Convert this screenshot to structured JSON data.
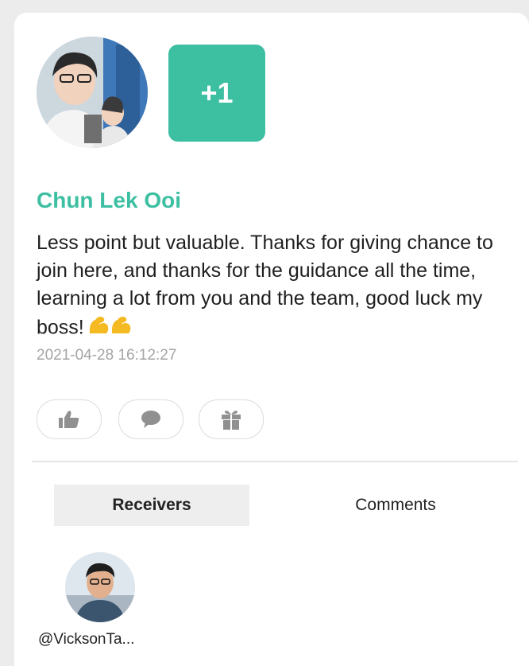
{
  "post": {
    "plus_label": "+1",
    "author_name": "Chun Lek Ooi",
    "message": "Less point but valuable. Thanks for giving chance to join here, and thanks for the guidance all the time, learning a lot from you and the team, good luck my boss!",
    "emoji_icons": [
      "flexed-biceps-icon",
      "flexed-biceps-icon"
    ],
    "timestamp": "2021-04-28 16:12:27"
  },
  "actions": [
    {
      "icon": "thumbs-up-icon"
    },
    {
      "icon": "comment-bubble-icon"
    },
    {
      "icon": "gift-icon"
    }
  ],
  "tabs": {
    "active": "receivers",
    "receivers_label": "Receivers",
    "comments_label": "Comments"
  },
  "receivers": [
    {
      "handle": "@VicksonTa..."
    }
  ],
  "colors": {
    "accent": "#3dbfa2",
    "page_background": "#ececec",
    "card_background": "#ffffff",
    "timestamp": "#a4a4a4",
    "action_icon": "#909090",
    "emoji": "#f5b921"
  }
}
